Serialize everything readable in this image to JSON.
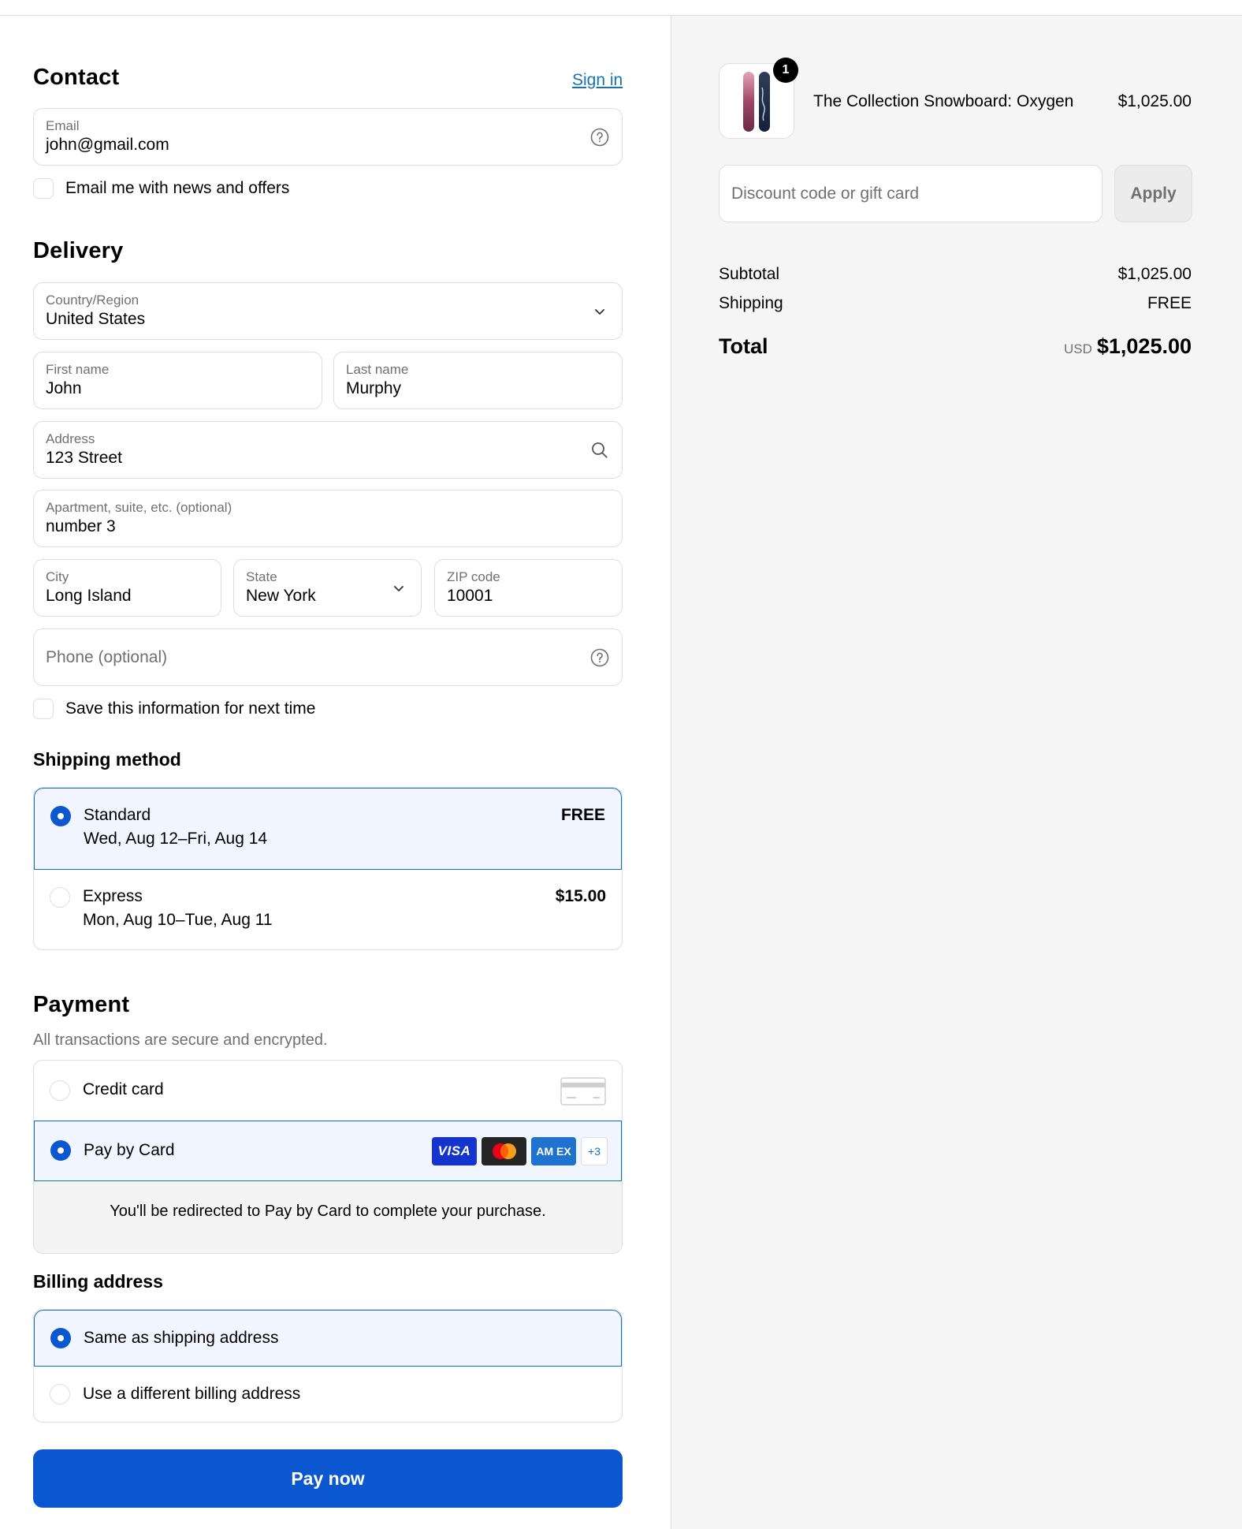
{
  "contact": {
    "title": "Contact",
    "sign_in": "Sign in",
    "email_label": "Email",
    "email_value": "john@gmail.com",
    "news_offers": "Email me with news and offers"
  },
  "delivery": {
    "title": "Delivery",
    "country_label": "Country/Region",
    "country_value": "United States",
    "first_name_label": "First name",
    "first_name_value": "John",
    "last_name_label": "Last name",
    "last_name_value": "Murphy",
    "address_label": "Address",
    "address_value": "123 Street",
    "apartment_label": "Apartment, suite, etc. (optional)",
    "apartment_value": "number 3",
    "city_label": "City",
    "city_value": "Long Island",
    "state_label": "State",
    "state_value": "New York",
    "zip_label": "ZIP code",
    "zip_value": "10001",
    "phone_placeholder": "Phone (optional)",
    "save_info": "Save this information for next time"
  },
  "shipping_method": {
    "title": "Shipping method",
    "options": [
      {
        "name": "Standard",
        "dates": "Wed, Aug 12–Fri, Aug 14",
        "price": "FREE",
        "selected": true
      },
      {
        "name": "Express",
        "dates": "Mon, Aug 10–Tue, Aug 11",
        "price": "$15.00",
        "selected": false
      }
    ]
  },
  "payment": {
    "title": "Payment",
    "subtitle": "All transactions are secure and encrypted.",
    "credit_card": "Credit card",
    "pay_by_card": "Pay by Card",
    "more_cards": "+3",
    "card_logos": [
      "VISA",
      "AM EX"
    ],
    "redirect_note": "You'll be redirected to Pay by Card to complete your purchase."
  },
  "billing": {
    "title": "Billing address",
    "same": "Same as shipping address",
    "different": "Use a different billing address"
  },
  "pay_now": "Pay now",
  "summary": {
    "product_name": "The Collection Snowboard: Oxygen",
    "product_price": "$1,025.00",
    "quantity_badge": "1",
    "discount_placeholder": "Discount code or gift card",
    "apply": "Apply",
    "subtotal_label": "Subtotal",
    "subtotal_value": "$1,025.00",
    "shipping_label": "Shipping",
    "shipping_value": "FREE",
    "total_label": "Total",
    "currency": "USD",
    "total_value": "$1,025.00"
  },
  "colors": {
    "accent": "#0b57d0",
    "link": "#1773b0",
    "selected_bg": "#f0f5ff",
    "summary_bg": "#f5f5f5"
  }
}
